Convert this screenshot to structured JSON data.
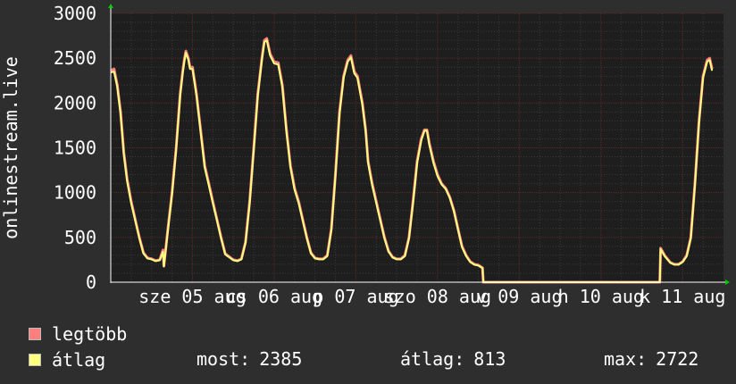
{
  "chart_data": {
    "type": "line",
    "ylabel": "onlinestream.live",
    "ylim": [
      0,
      3000
    ],
    "yticks": [
      "0",
      "500",
      "1000",
      "1500",
      "2000",
      "2500",
      "3000"
    ],
    "xlim_days": [
      0,
      7.5
    ],
    "xticks": [
      {
        "day": 1,
        "label": "sze 05 aug"
      },
      {
        "day": 2,
        "label": "cs 06 aug"
      },
      {
        "day": 3,
        "label": "p 07 aug"
      },
      {
        "day": 4,
        "label": "szo 08 aug"
      },
      {
        "day": 5,
        "label": "v 09 aug"
      },
      {
        "day": 6,
        "label": "h 10 aug"
      },
      {
        "day": 7,
        "label": "k 11 aug"
      }
    ],
    "grid": true,
    "series": [
      {
        "name": "legtöbb",
        "color": "#ff7f7f",
        "points": [
          [
            0.0,
            2360
          ],
          [
            0.04,
            2380
          ],
          [
            0.08,
            2200
          ],
          [
            0.12,
            1900
          ],
          [
            0.16,
            1450
          ],
          [
            0.2,
            1150
          ],
          [
            0.25,
            900
          ],
          [
            0.3,
            700
          ],
          [
            0.35,
            500
          ],
          [
            0.4,
            330
          ],
          [
            0.45,
            270
          ],
          [
            0.5,
            260
          ],
          [
            0.55,
            240
          ],
          [
            0.6,
            250
          ],
          [
            0.64,
            360
          ],
          [
            0.65,
            180
          ],
          [
            0.7,
            600
          ],
          [
            0.75,
            1000
          ],
          [
            0.8,
            1500
          ],
          [
            0.85,
            2100
          ],
          [
            0.88,
            2350
          ],
          [
            0.9,
            2480
          ],
          [
            0.92,
            2580
          ],
          [
            0.95,
            2500
          ],
          [
            0.97,
            2400
          ],
          [
            1.0,
            2400
          ],
          [
            1.05,
            2100
          ],
          [
            1.1,
            1700
          ],
          [
            1.15,
            1300
          ],
          [
            1.2,
            1100
          ],
          [
            1.25,
            900
          ],
          [
            1.3,
            700
          ],
          [
            1.35,
            500
          ],
          [
            1.4,
            320
          ],
          [
            1.5,
            250
          ],
          [
            1.55,
            240
          ],
          [
            1.6,
            260
          ],
          [
            1.65,
            450
          ],
          [
            1.7,
            900
          ],
          [
            1.75,
            1500
          ],
          [
            1.8,
            2100
          ],
          [
            1.85,
            2500
          ],
          [
            1.88,
            2700
          ],
          [
            1.91,
            2720
          ],
          [
            1.95,
            2550
          ],
          [
            2.0,
            2460
          ],
          [
            2.05,
            2450
          ],
          [
            2.1,
            2200
          ],
          [
            2.15,
            1700
          ],
          [
            2.2,
            1300
          ],
          [
            2.25,
            1050
          ],
          [
            2.3,
            900
          ],
          [
            2.35,
            700
          ],
          [
            2.4,
            500
          ],
          [
            2.45,
            330
          ],
          [
            2.5,
            270
          ],
          [
            2.55,
            260
          ],
          [
            2.6,
            260
          ],
          [
            2.65,
            300
          ],
          [
            2.7,
            600
          ],
          [
            2.75,
            1200
          ],
          [
            2.8,
            1900
          ],
          [
            2.85,
            2300
          ],
          [
            2.9,
            2480
          ],
          [
            2.94,
            2530
          ],
          [
            2.98,
            2350
          ],
          [
            3.02,
            2300
          ],
          [
            3.08,
            2000
          ],
          [
            3.12,
            1700
          ],
          [
            3.15,
            1350
          ],
          [
            3.2,
            1100
          ],
          [
            3.25,
            900
          ],
          [
            3.3,
            700
          ],
          [
            3.35,
            500
          ],
          [
            3.4,
            350
          ],
          [
            3.45,
            280
          ],
          [
            3.5,
            260
          ],
          [
            3.55,
            260
          ],
          [
            3.6,
            300
          ],
          [
            3.65,
            500
          ],
          [
            3.7,
            900
          ],
          [
            3.75,
            1350
          ],
          [
            3.8,
            1600
          ],
          [
            3.84,
            1700
          ],
          [
            3.87,
            1700
          ],
          [
            3.9,
            1550
          ],
          [
            3.95,
            1350
          ],
          [
            4.0,
            1200
          ],
          [
            4.05,
            1100
          ],
          [
            4.1,
            1050
          ],
          [
            4.15,
            950
          ],
          [
            4.2,
            800
          ],
          [
            4.25,
            600
          ],
          [
            4.3,
            400
          ],
          [
            4.35,
            300
          ],
          [
            4.4,
            230
          ],
          [
            4.45,
            200
          ],
          [
            4.5,
            190
          ],
          [
            4.55,
            160
          ],
          [
            4.56,
            0
          ],
          [
            5.0,
            0
          ],
          [
            6.0,
            0
          ],
          [
            6.72,
            0
          ],
          [
            6.73,
            380
          ],
          [
            6.78,
            300
          ],
          [
            6.85,
            220
          ],
          [
            6.9,
            200
          ],
          [
            6.95,
            200
          ],
          [
            7.0,
            230
          ],
          [
            7.05,
            300
          ],
          [
            7.1,
            500
          ],
          [
            7.15,
            1100
          ],
          [
            7.2,
            1800
          ],
          [
            7.25,
            2300
          ],
          [
            7.3,
            2480
          ],
          [
            7.33,
            2500
          ],
          [
            7.36,
            2380
          ]
        ]
      },
      {
        "name": "átlag",
        "color": "#ffff80",
        "points": [
          [
            0.0,
            2340
          ],
          [
            0.04,
            2350
          ],
          [
            0.08,
            2180
          ],
          [
            0.12,
            1880
          ],
          [
            0.16,
            1430
          ],
          [
            0.2,
            1130
          ],
          [
            0.25,
            880
          ],
          [
            0.3,
            690
          ],
          [
            0.35,
            490
          ],
          [
            0.4,
            320
          ],
          [
            0.45,
            265
          ],
          [
            0.5,
            255
          ],
          [
            0.55,
            235
          ],
          [
            0.6,
            245
          ],
          [
            0.64,
            340
          ],
          [
            0.65,
            175
          ],
          [
            0.7,
            580
          ],
          [
            0.75,
            980
          ],
          [
            0.8,
            1480
          ],
          [
            0.85,
            2080
          ],
          [
            0.88,
            2330
          ],
          [
            0.9,
            2460
          ],
          [
            0.92,
            2560
          ],
          [
            0.95,
            2480
          ],
          [
            0.97,
            2380
          ],
          [
            1.0,
            2380
          ],
          [
            1.05,
            2080
          ],
          [
            1.1,
            1680
          ],
          [
            1.15,
            1280
          ],
          [
            1.2,
            1080
          ],
          [
            1.25,
            880
          ],
          [
            1.3,
            690
          ],
          [
            1.35,
            490
          ],
          [
            1.4,
            310
          ],
          [
            1.5,
            245
          ],
          [
            1.55,
            235
          ],
          [
            1.6,
            255
          ],
          [
            1.65,
            440
          ],
          [
            1.7,
            880
          ],
          [
            1.75,
            1480
          ],
          [
            1.8,
            2080
          ],
          [
            1.85,
            2480
          ],
          [
            1.88,
            2680
          ],
          [
            1.91,
            2700
          ],
          [
            1.95,
            2530
          ],
          [
            2.0,
            2440
          ],
          [
            2.05,
            2430
          ],
          [
            2.1,
            2180
          ],
          [
            2.15,
            1680
          ],
          [
            2.2,
            1280
          ],
          [
            2.25,
            1030
          ],
          [
            2.3,
            880
          ],
          [
            2.35,
            690
          ],
          [
            2.4,
            490
          ],
          [
            2.45,
            320
          ],
          [
            2.5,
            265
          ],
          [
            2.55,
            255
          ],
          [
            2.6,
            255
          ],
          [
            2.65,
            290
          ],
          [
            2.7,
            580
          ],
          [
            2.75,
            1180
          ],
          [
            2.8,
            1880
          ],
          [
            2.85,
            2280
          ],
          [
            2.9,
            2460
          ],
          [
            2.94,
            2510
          ],
          [
            2.98,
            2330
          ],
          [
            3.02,
            2280
          ],
          [
            3.08,
            1980
          ],
          [
            3.12,
            1680
          ],
          [
            3.15,
            1330
          ],
          [
            3.2,
            1080
          ],
          [
            3.25,
            880
          ],
          [
            3.3,
            690
          ],
          [
            3.35,
            490
          ],
          [
            3.4,
            340
          ],
          [
            3.45,
            275
          ],
          [
            3.5,
            255
          ],
          [
            3.55,
            255
          ],
          [
            3.6,
            290
          ],
          [
            3.65,
            490
          ],
          [
            3.7,
            880
          ],
          [
            3.75,
            1330
          ],
          [
            3.8,
            1580
          ],
          [
            3.84,
            1690
          ],
          [
            3.87,
            1690
          ],
          [
            3.9,
            1530
          ],
          [
            3.95,
            1330
          ],
          [
            4.0,
            1180
          ],
          [
            4.05,
            1090
          ],
          [
            4.1,
            1040
          ],
          [
            4.15,
            940
          ],
          [
            4.2,
            790
          ],
          [
            4.25,
            590
          ],
          [
            4.3,
            390
          ],
          [
            4.35,
            290
          ],
          [
            4.4,
            225
          ],
          [
            4.45,
            195
          ],
          [
            4.5,
            185
          ],
          [
            4.55,
            155
          ],
          [
            4.56,
            0
          ],
          [
            5.0,
            0
          ],
          [
            6.0,
            0
          ],
          [
            6.72,
            0
          ],
          [
            6.73,
            370
          ],
          [
            6.78,
            290
          ],
          [
            6.85,
            215
          ],
          [
            6.9,
            195
          ],
          [
            6.95,
            195
          ],
          [
            7.0,
            225
          ],
          [
            7.05,
            290
          ],
          [
            7.1,
            490
          ],
          [
            7.15,
            1080
          ],
          [
            7.2,
            1780
          ],
          [
            7.25,
            2280
          ],
          [
            7.3,
            2460
          ],
          [
            7.33,
            2480
          ],
          [
            7.36,
            2360
          ]
        ]
      }
    ]
  },
  "legend": {
    "max_label": "legtöbb",
    "avg_label": "átlag"
  },
  "stats": {
    "most_label": "most:",
    "most_value": "2385",
    "atlag_label": "átlag:",
    "atlag_value": "813",
    "max_label": "max:",
    "max_value": "2722"
  },
  "colors": {
    "background": "#2e2e2e",
    "plot_background": "#1e1e1e",
    "grid": "#5a2a2a",
    "axis": "#ffffff",
    "arrow": "#00cc00"
  }
}
